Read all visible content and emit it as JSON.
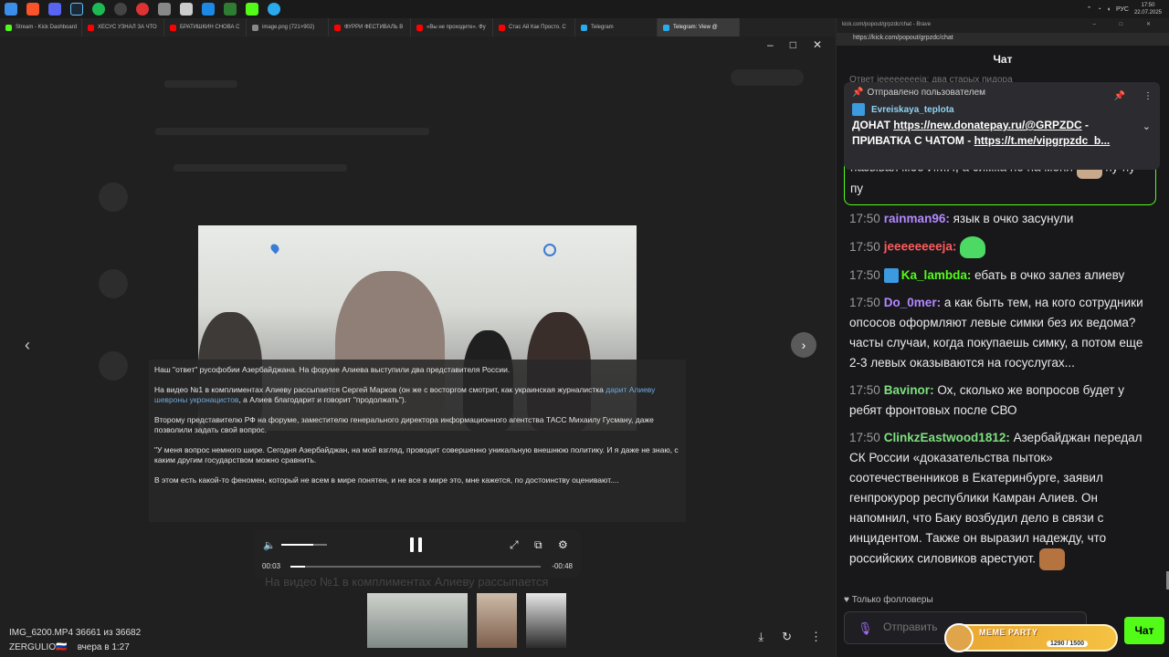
{
  "taskbar": {
    "lang": "РУС",
    "time": "17:50",
    "date": "22.07.2025"
  },
  "browser_tabs": [
    {
      "label": "Stream - Kick Dashboard",
      "color": "#53fc18"
    },
    {
      "label": "ХЕСУС УЗНАЛ ЗА ЧТО",
      "color": "#ff0000"
    },
    {
      "label": "БРАТИШКИН СНОВА С",
      "color": "#ff0000"
    },
    {
      "label": "image.png (721×902)",
      "color": "#888888"
    },
    {
      "label": "ФУРРИ ФЕСТИВАЛЬ В",
      "color": "#ff0000"
    },
    {
      "label": "«Вы не проходите». Фу",
      "color": "#ff0000"
    },
    {
      "label": "Стас Ай Как Просто. С",
      "color": "#ff0000"
    },
    {
      "label": "Telegram",
      "color": "#2aabee"
    },
    {
      "label": "Telegram: View @",
      "color": "#2aabee",
      "active": true
    }
  ],
  "viewer": {
    "caption_paragraphs": [
      "Наш \"ответ\" русофобии Азербайджана. На форуме Алиева выступили два представителя России.",
      "На видео №1 в комплиментах Алиеву рассыпается Сергей Марков (он же с восторгом смотрит, как украинская журналистка дарит Алиеву шевроны укронацистов, а Алиев благодарит и говорит \"продолжать\").",
      "Второму представителю РФ на форуме, заместителю генерального директора информационного агентства ТАСС Михаилу Гусману, даже позволили задать свой вопрос.",
      "\"У меня вопрос немного шире. Сегодня Азербайджан, на мой взгляд, проводит совершенно уникальную внешнюю политику. И я даже не знаю, с каким другим государством можно сравнить.",
      "В этом есть какой-то феномен, который не всем в мире понятен, и не все в мире это, мне кажется, по достоинству оценивают...."
    ],
    "caption_link": "дарит Алиеву шевроны укронацистов",
    "time_current": "00:03",
    "time_remaining": "-00:48",
    "progress": 0.06,
    "volume": 0.7,
    "under_text": "На видео №1 в комплиментах Алиеву рассыпается",
    "file_name": "IMG_6200.MP4",
    "file_counter": "36661 из 36682",
    "author": "ZERGULIO🇷🇺",
    "posted": "вчера в 1:27"
  },
  "chat": {
    "window_title": "kick.com/popout/grpzdc/chat - Brave",
    "url": "https://kick.com/popout/grpzdc/chat",
    "header": "Чат",
    "ghost_msg": "Ответ jeeeeeeeeja: два старых пидора",
    "pinned": {
      "label": "Отправлено пользователем",
      "user": "Evreiskaya_teplota",
      "line1_prefix": "ДОНАТ ",
      "line1_link": "https://new.donatepay.ru/@GRPZDC",
      "line1_suffix": " -",
      "line2_prefix": "ПРИВАТКА С ЧАТОМ - ",
      "line2_link": "https://t.me/vipgrpzdc_b..."
    },
    "continued_text_a": "называя мое ИМЯ, а симка не на меня",
    "continued_text_b": "пу-пу-пу",
    "messages": [
      {
        "time": "17:50",
        "user": "rainman96",
        "color": "#b388ff",
        "text": "язык в очко засунули"
      },
      {
        "time": "17:50",
        "user": "jeeeeeeeeja",
        "color": "#ff5b5b",
        "text": ""
      },
      {
        "time": "17:50",
        "user": "Ka_lambda",
        "color": "#53fc18",
        "text": "ебать в очко залез алиеву"
      },
      {
        "time": "17:50",
        "user": "Do_0mer",
        "color": "#b388ff",
        "text": "а как быть тем, на кого сотрудники опсосов оформляют левые симки без их ведома? часты случаи, когда покупаешь симку, а потом еще 2-3 левых оказываются на госуслугах..."
      },
      {
        "time": "17:50",
        "user": "Bavinor",
        "color": "#7ee07e",
        "text": "Ох, сколько же вопросов будет у ребят фронтовых после СВО"
      },
      {
        "time": "17:50",
        "user": "ClinkzEastwood1812",
        "color": "#7ee07e",
        "text": "Азербайджан передал СК России «доказательства пыток» соотечественников в Екатеринбурге, заявил генпрокурор республики Камран Алиев. Он напомнил, что Баку возбудил дело в связи с инцидентом. Также он выразил надежду, что российских силовиков арестуют."
      }
    ],
    "followers_only": "Только фолловеры",
    "input_placeholder": "Отправить",
    "meme_party_title": "MEME PARTY",
    "meme_party_progress": "1290 / 1500",
    "send_label": "Чат"
  }
}
